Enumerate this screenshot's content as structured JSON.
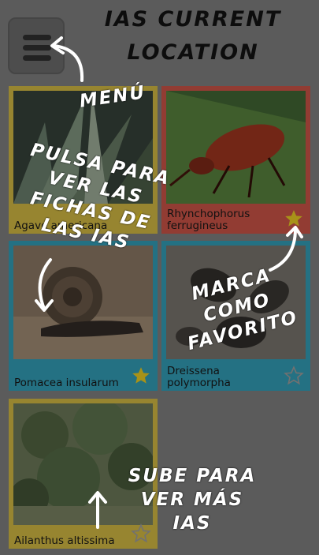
{
  "header": {
    "title": "IAS CURRENT LOCATION"
  },
  "menu": {
    "icon": "hamburger-menu-icon"
  },
  "colors": {
    "card_yellow": "#b9a33b",
    "card_red": "#b24a3f",
    "card_blue": "#2c8aa0",
    "star_filled": "#cdb21e",
    "star_empty": "#8a8a8a"
  },
  "species": [
    {
      "name": "Agave americana",
      "favorite": true
    },
    {
      "name": "Rhynchophorus ferrugineus",
      "favorite": true
    },
    {
      "name": "Pomacea insularum",
      "favorite": true
    },
    {
      "name": "Dreissena polymorpha",
      "favorite": false
    },
    {
      "name": "Ailanthus altissima",
      "favorite": false
    }
  ],
  "hints": {
    "menu": "MENÚ",
    "open_card": "PULSA PARA VER LAS FICHAS DE LAS IAS",
    "favorite": "MARCA COMO FAVORITO",
    "scroll": "SUBE PARA VER MÁS IAS"
  }
}
